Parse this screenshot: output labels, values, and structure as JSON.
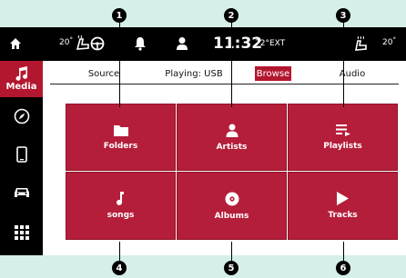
{
  "status": {
    "left_temp": "20",
    "time": "11:32",
    "ext_temp": "72°EXT",
    "right_temp": "20"
  },
  "sidebar": {
    "items": [
      {
        "icon": "music-note-icon",
        "label": "Media"
      },
      {
        "icon": "navigation-icon",
        "label": ""
      },
      {
        "icon": "phone-icon",
        "label": ""
      },
      {
        "icon": "car-icon",
        "label": ""
      },
      {
        "icon": "apps-grid-icon",
        "label": ""
      }
    ]
  },
  "tabs": [
    {
      "label": "Source"
    },
    {
      "label": "Playing: USB"
    },
    {
      "label": "Browse",
      "active": true
    },
    {
      "label": "Audio"
    }
  ],
  "tiles": [
    {
      "label": "Folders",
      "icon": "folder-icon"
    },
    {
      "label": "Artists",
      "icon": "person-icon"
    },
    {
      "label": "Playlists",
      "icon": "playlist-icon"
    },
    {
      "label": "songs",
      "icon": "music-note-icon"
    },
    {
      "label": "Albums",
      "icon": "album-disc-icon"
    },
    {
      "label": "Tracks",
      "icon": "play-icon"
    }
  ],
  "callouts": [
    "1",
    "2",
    "3",
    "4",
    "5",
    "6"
  ],
  "colors": {
    "accent": "#b51e3a",
    "bezel": "#d6efe9"
  }
}
